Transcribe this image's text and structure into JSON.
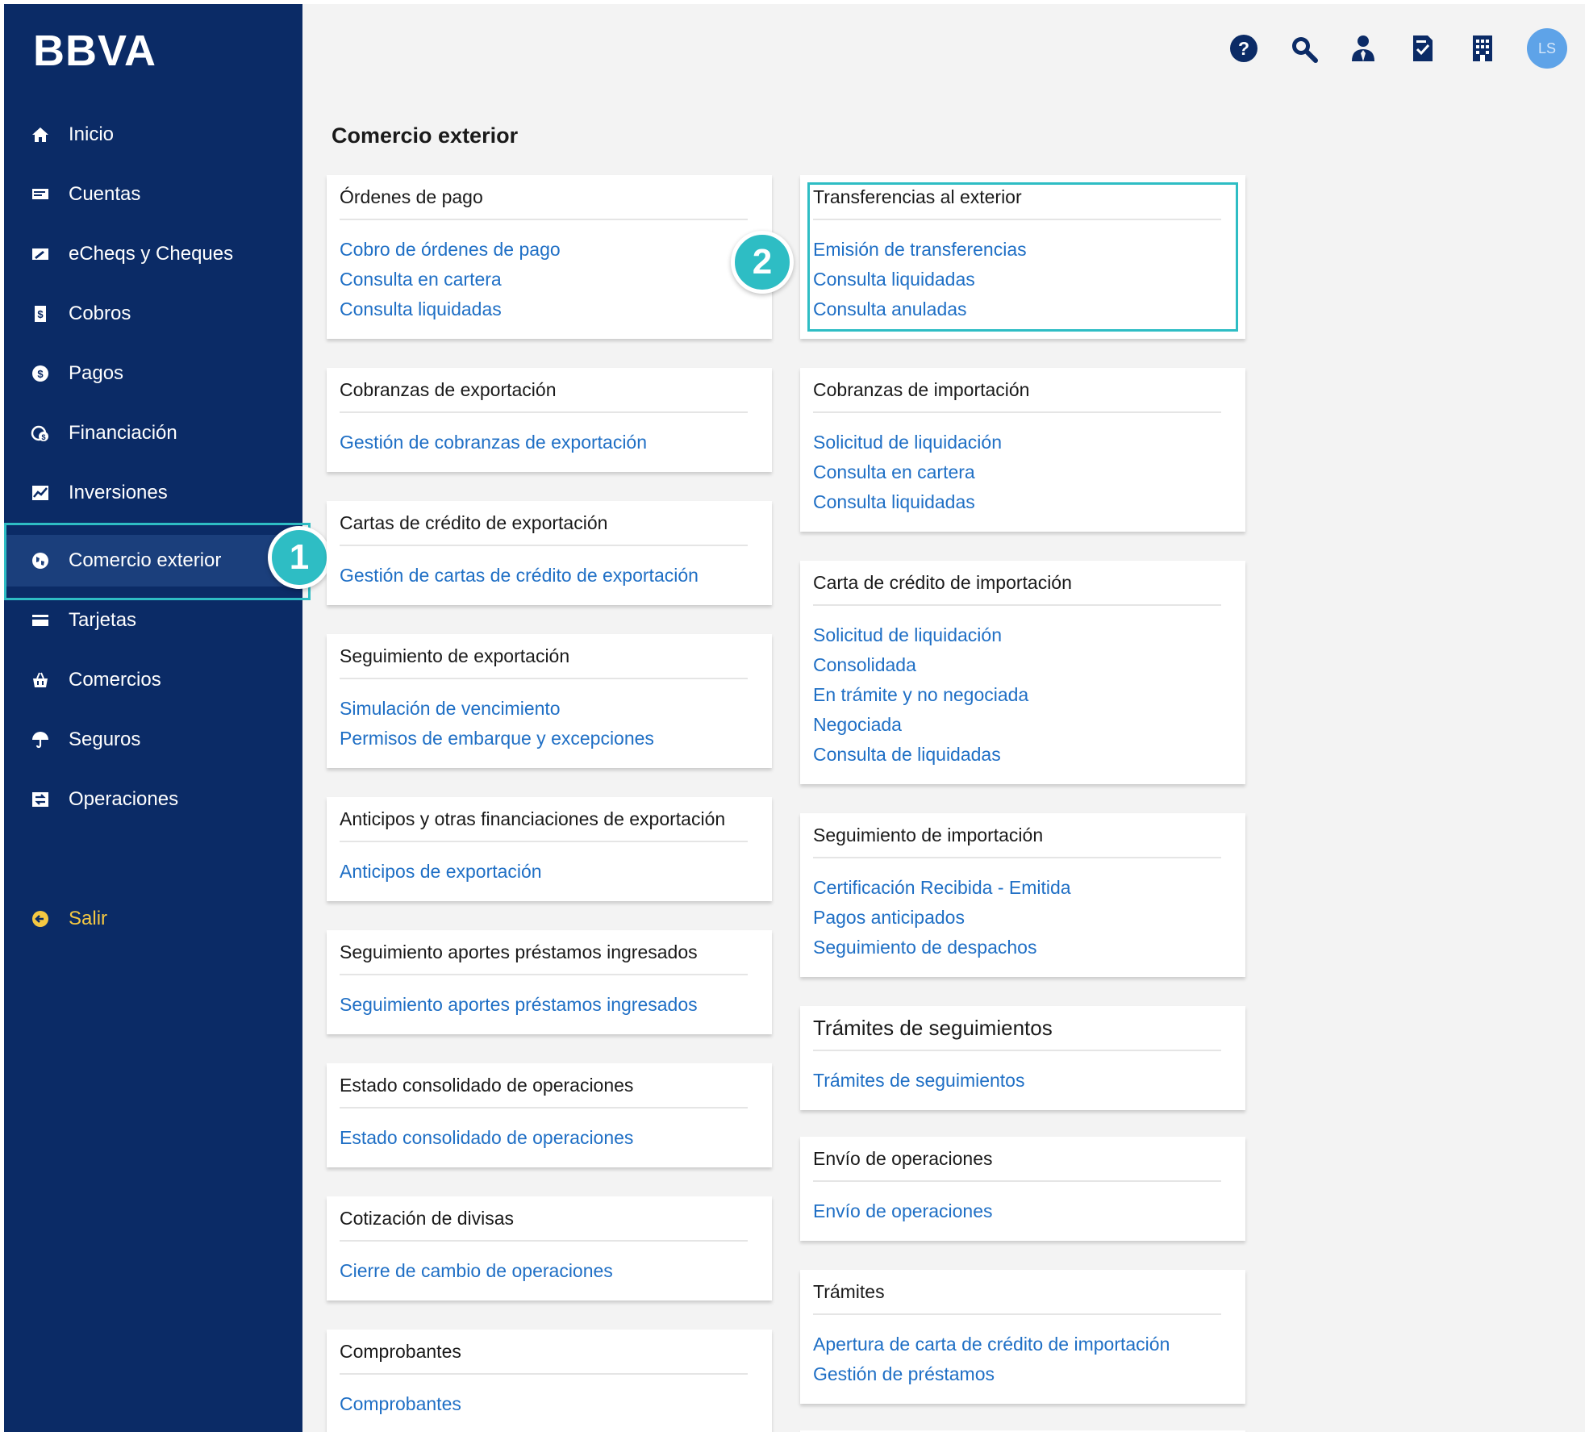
{
  "brand": {
    "logo_text": "BBVA"
  },
  "colors": {
    "sidebar": "#0b2b66",
    "link": "#1f6fc5",
    "highlight": "#2ebdc4",
    "exit": "#f5c842"
  },
  "sidebar": {
    "items": [
      {
        "label": "Inicio",
        "icon": "home-icon"
      },
      {
        "label": "Cuentas",
        "icon": "accounts-icon"
      },
      {
        "label": "eCheqs y Cheques",
        "icon": "cheque-icon"
      },
      {
        "label": "Cobros",
        "icon": "collections-icon"
      },
      {
        "label": "Pagos",
        "icon": "payments-icon"
      },
      {
        "label": "Financiación",
        "icon": "financing-icon"
      },
      {
        "label": "Inversiones",
        "icon": "investments-icon"
      },
      {
        "label": "Comercio exterior",
        "icon": "globe-icon"
      },
      {
        "label": "Tarjetas",
        "icon": "card-icon"
      },
      {
        "label": "Comercios",
        "icon": "shop-icon"
      },
      {
        "label": "Seguros",
        "icon": "umbrella-icon"
      },
      {
        "label": "Operaciones",
        "icon": "operations-icon"
      }
    ],
    "exit": {
      "label": "Salir",
      "icon": "exit-icon"
    }
  },
  "header": {
    "icons": [
      "help-icon",
      "search-icon",
      "user-icon",
      "document-check-icon",
      "building-icon"
    ],
    "avatar_initials": "LS"
  },
  "badges": {
    "one": "1",
    "two": "2"
  },
  "page": {
    "title": "Comercio exterior"
  },
  "left_cards": [
    {
      "title": "Órdenes de pago",
      "links": [
        "Cobro de órdenes de pago",
        "Consulta en cartera",
        "Consulta liquidadas"
      ]
    },
    {
      "title": "Cobranzas de exportación",
      "links": [
        "Gestión de cobranzas de exportación"
      ]
    },
    {
      "title": "Cartas de crédito de exportación",
      "links": [
        "Gestión de cartas de crédito de exportación"
      ]
    },
    {
      "title": "Seguimiento de exportación",
      "links": [
        "Simulación de vencimiento",
        "Permisos de embarque y excepciones"
      ]
    },
    {
      "title": "Anticipos y otras financiaciones de exportación",
      "links": [
        "Anticipos de exportación"
      ]
    },
    {
      "title": "Seguimiento aportes préstamos ingresados",
      "links": [
        "Seguimiento aportes préstamos ingresados"
      ]
    },
    {
      "title": "Estado consolidado de operaciones",
      "links": [
        "Estado consolidado de operaciones"
      ]
    },
    {
      "title": "Cotización de divisas",
      "links": [
        "Cierre de cambio de operaciones"
      ]
    },
    {
      "title": "Comprobantes",
      "links": [
        "Comprobantes"
      ]
    }
  ],
  "right_cards": [
    {
      "title": "Transferencias al exterior",
      "links": [
        "Emisión de transferencias",
        "Consulta liquidadas",
        "Consulta anuladas"
      ]
    },
    {
      "title": "Cobranzas de importación",
      "links": [
        "Solicitud de liquidación",
        "Consulta en cartera",
        "Consulta liquidadas"
      ]
    },
    {
      "title": "Carta de crédito de importación",
      "links": [
        "Solicitud de liquidación",
        "Consolidada",
        "En trámite y no negociada",
        "Negociada",
        "Consulta de liquidadas"
      ]
    },
    {
      "title": "Seguimiento de importación",
      "links": [
        "Certificación Recibida - Emitida",
        "Pagos anticipados",
        "Seguimiento de despachos"
      ]
    },
    {
      "title": "Trámites de seguimientos",
      "links": [
        "Trámites de seguimientos"
      ]
    },
    {
      "title": "Envío de operaciones",
      "links": [
        "Envío de operaciones"
      ]
    },
    {
      "title": "Trámites",
      "links": [
        "Apertura de carta de crédito de importación",
        "Gestión de préstamos"
      ]
    }
  ]
}
